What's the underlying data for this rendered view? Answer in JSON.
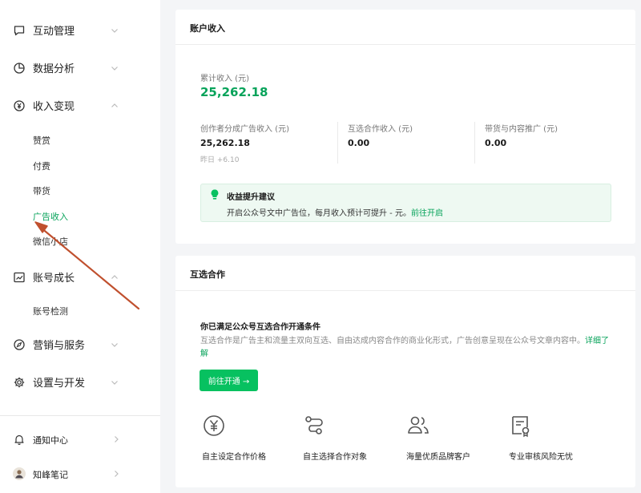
{
  "sidebar": {
    "groups": [
      {
        "label": "互动管理",
        "icon": "chat-bubble-icon"
      },
      {
        "label": "数据分析",
        "icon": "pie-chart-icon"
      },
      {
        "label": "收入变现",
        "icon": "yen-circle-icon"
      },
      {
        "label": "账号成长",
        "icon": "trend-chart-icon"
      },
      {
        "label": "营销与服务",
        "icon": "compass-icon"
      },
      {
        "label": "设置与开发",
        "icon": "gear-icon"
      }
    ],
    "income_items": [
      "赞赏",
      "付费",
      "带货",
      "广告收入",
      "微信小店"
    ],
    "active_item": "广告收入",
    "growth_items": [
      "账号检测"
    ],
    "footer": {
      "notification": "通知中心",
      "account": "知峰笔记"
    }
  },
  "income_panel": {
    "title": "账户收入",
    "cumulative_label": "累计收入 (元)",
    "cumulative_value": "25,262.18",
    "stats": [
      {
        "label": "创作者分成广告收入 (元)",
        "value": "25,262.18",
        "yesterday": "昨日 +6.10"
      },
      {
        "label": "互选合作收入 (元)",
        "value": "0.00"
      },
      {
        "label": "带货与内容推广 (元)",
        "value": "0.00"
      }
    ],
    "tip": {
      "title": "收益提升建议",
      "text": "开启公众号文中广告位，每月收入预计可提升 - 元。",
      "link": "前往开启"
    }
  },
  "coop_panel": {
    "title": "互选合作",
    "heading": "你已满足公众号互选合作开通条件",
    "description": "互选合作是广告主和流量主双向互选、自由达成内容合作的商业化形式，广告创意呈现在公众号文章内容中。",
    "detail_link": "详细了解",
    "button": "前往开通 →",
    "features": [
      {
        "label": "自主设定合作价格",
        "icon": "yen-circle-icon"
      },
      {
        "label": "自主选择合作对象",
        "icon": "route-icon"
      },
      {
        "label": "海量优质品牌客户",
        "icon": "users-icon"
      },
      {
        "label": "专业审核风险无忧",
        "icon": "certificate-icon"
      }
    ]
  },
  "colors": {
    "accent": "#07c160",
    "accent_text": "#07a35a",
    "annotation_arrow": "#c0502e"
  }
}
